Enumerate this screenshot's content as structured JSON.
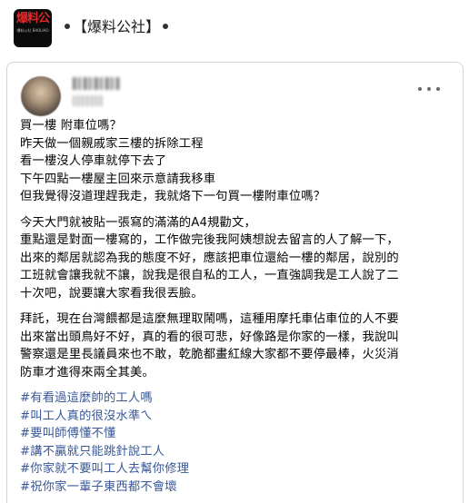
{
  "page": {
    "logo_text": "爆料公",
    "logo_subtext": "爆料公社 BAOLIAO",
    "name": "【爆料公社】"
  },
  "post": {
    "paragraphs": [
      [
        "買一樓 附車位嗎？",
        "昨天做一個親戚家三樓的拆除工程",
        "看一樓沒人停車就停下去了",
        "下午四點一樓屋主回來示意請我移車",
        "但我覺得沒道理趕我走，我就烙下一句買一樓附車位嗎？"
      ],
      [
        "今天大門就被貼一張寫的滿滿的A4規勸文，",
        "重點還是對面一樓寫的，工作做完後我阿姨想說去留言的人了解一下，",
        "出來的鄰居就認為我的態度不好，應該把車位還給一樓的鄰居，說別的",
        "工班就會讓我就不讓，說我是很自私的工人，一直強調我是工人說了二",
        "十次吧，說要讓大家看我很丟臉。"
      ],
      [
        "拜託，現在台灣餵都是這麼無理取鬧嗎，這種用摩托車佔車位的人不要",
        "出來當出頭鳥好不好，真的看的很可悲，好像路是你家的一樣，我說叫",
        "警察還是里長議員來也不敢，乾脆都畫紅線大家都不要停最棒，火災消",
        "防車才進得來兩全其美。"
      ]
    ],
    "hashtags": [
      "#有看過這麼帥的工人嗎",
      "#叫工人真的很沒水準ㄟ",
      "#要叫師傅懂不懂",
      "#講不贏就只能跳針說工人",
      "#你家就不要叫工人去幫你修理",
      "#祝你家一輩子東西都不會壞"
    ]
  },
  "colors": {
    "hashtag": "#385898",
    "text": "#050505",
    "border": "#d4d4d4"
  }
}
